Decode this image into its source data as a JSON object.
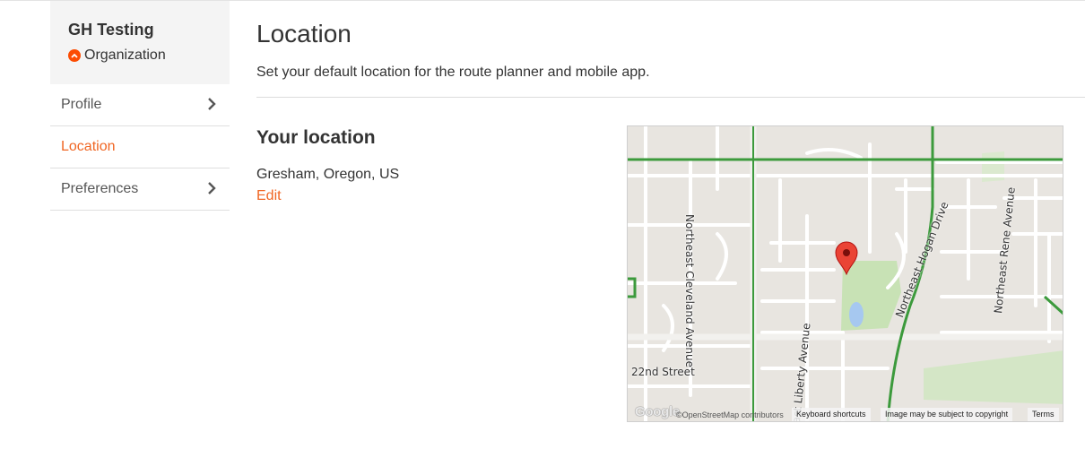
{
  "organization": {
    "name": "GH Testing",
    "type_label": "Organization",
    "badge_icon": "chevron-up-circle-icon",
    "accent_color": "#fc4c02"
  },
  "sidebar": {
    "items": [
      {
        "label": "Profile",
        "active": false,
        "icon": "chevron-right-icon"
      },
      {
        "label": "Location",
        "active": true
      },
      {
        "label": "Preferences",
        "active": false,
        "icon": "chevron-right-icon"
      }
    ],
    "active_color": "#f06623"
  },
  "main": {
    "title": "Location",
    "description": "Set your default location for the route planner and mobile app.",
    "section_title": "Your location",
    "location_value": "Gresham, Oregon, US",
    "edit_label": "Edit"
  },
  "map": {
    "street_labels": [
      "Northeast Cleveland Avenue",
      "Northeast Hogan Drive",
      "Northeast Rene Avenue",
      "East Liberty Avenue",
      "22nd Street"
    ],
    "logo_text": "Google",
    "osm_credit": "©OpenStreetMap contributors",
    "keyboard_shortcuts": "Keyboard shortcuts",
    "copyright_notice": "Image may be subject to copyright",
    "terms": "Terms",
    "marker_icon": "map-marker-icon",
    "marker_color": "#ea4335"
  }
}
